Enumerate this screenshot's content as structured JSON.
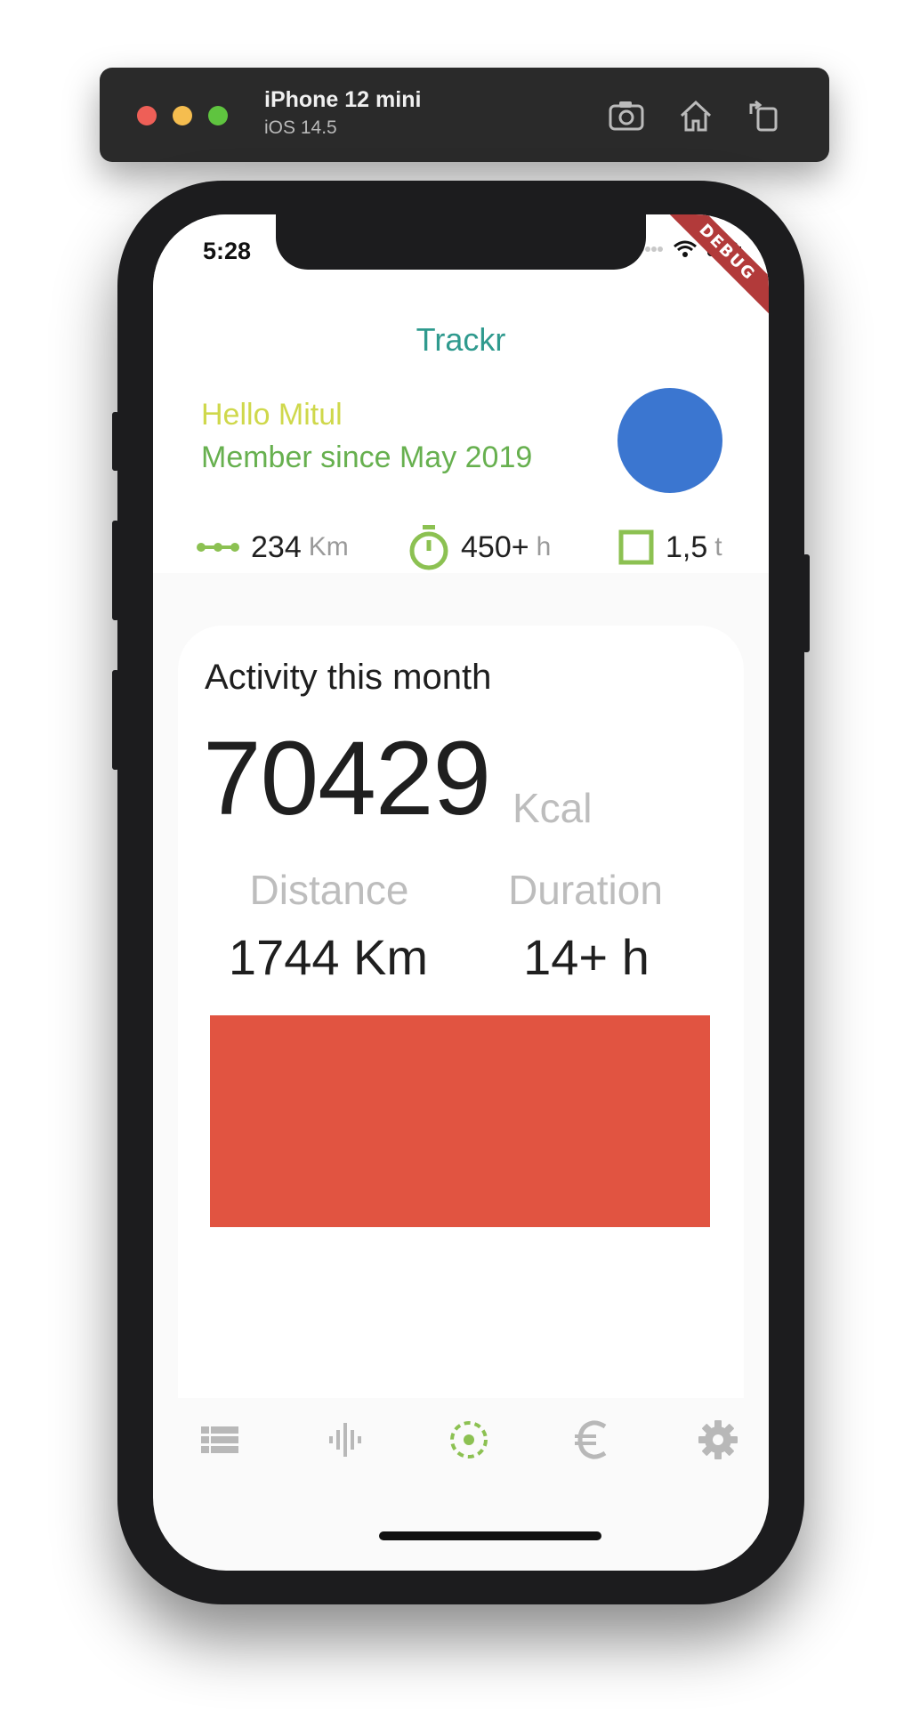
{
  "simulator": {
    "device_name": "iPhone 12 mini",
    "os_version": "iOS 14.5",
    "buttons": [
      "screenshot-icon",
      "home-icon",
      "rotate-icon"
    ]
  },
  "status_bar": {
    "time": "5:28",
    "debug_label": "DEBUG"
  },
  "app": {
    "title": "Trackr",
    "greeting": "Hello Mitul",
    "member_since": "Member since May 2019",
    "colors": {
      "title": "#2f9a8e",
      "greeting": "#cfd84b",
      "member": "#67b04f",
      "avatar": "#3b76d0",
      "accent": "#8cc152",
      "red_block": "#e15441"
    }
  },
  "stats": [
    {
      "icon": "route-icon",
      "value": "234",
      "unit": "Km"
    },
    {
      "icon": "stopwatch-icon",
      "value": "450+",
      "unit": "h"
    },
    {
      "icon": "square-icon",
      "value": "1,5",
      "unit": "t"
    }
  ],
  "activity": {
    "title": "Activity this month",
    "calories_value": "70429",
    "calories_unit": "Kcal",
    "distance_label": "Distance",
    "distance_value": "1744 Km",
    "duration_label": "Duration",
    "duration_value": "14+ h"
  },
  "bottom_nav": [
    {
      "icon": "list-icon",
      "active": false
    },
    {
      "icon": "waveform-icon",
      "active": false
    },
    {
      "icon": "target-icon",
      "active": true
    },
    {
      "icon": "euro-icon",
      "active": false
    },
    {
      "icon": "gear-icon",
      "active": false
    }
  ]
}
